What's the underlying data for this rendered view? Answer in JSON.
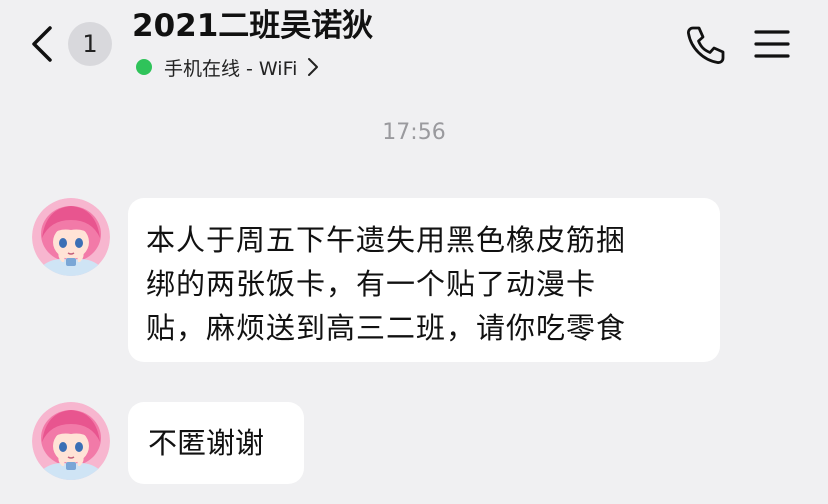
{
  "header": {
    "unread_count": "1",
    "title": "2021二班吴诺狄",
    "status_text": "手机在线 - WiFi",
    "status_color": "#2fc35a"
  },
  "icons": {
    "back": "back-chevron-icon",
    "status_dot": "online-dot-icon",
    "status_chevron": "chevron-right-icon",
    "call": "phone-icon",
    "menu": "hamburger-menu-icon"
  },
  "chat": {
    "timestamp": "17:56",
    "messages": [
      {
        "lines": [
          "本人于周五下午遗失用黑色橡皮筋捆",
          "绑的两张饭卡，有一个贴了动漫卡",
          "贴，麻烦送到高三二班，请你吃零食"
        ]
      },
      {
        "lines": [
          "不匿谢谢"
        ]
      }
    ]
  }
}
